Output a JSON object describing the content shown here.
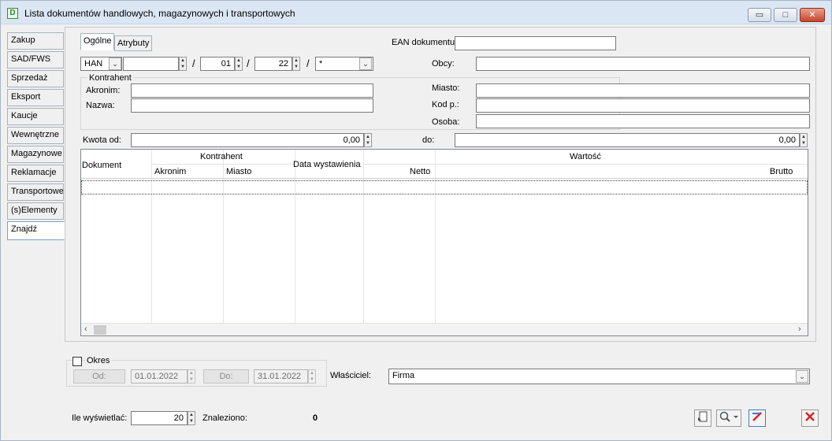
{
  "window": {
    "title": "Lista dokumentów handlowych, magazynowych i transportowych",
    "app_icon_letter": "D",
    "minimize_glyph": "▭",
    "maximize_glyph": "□",
    "close_glyph": "✕"
  },
  "sidebar": {
    "items": [
      {
        "label": "Zakup"
      },
      {
        "label": "SAD/FWS"
      },
      {
        "label": "Sprzedaż"
      },
      {
        "label": "Eksport"
      },
      {
        "label": "Kaucje"
      },
      {
        "label": "Wewnętrzne"
      },
      {
        "label": "Magazynowe"
      },
      {
        "label": "Reklamacje"
      },
      {
        "label": "Transportowe"
      },
      {
        "label": "(s)Elementy"
      },
      {
        "label": "Znajdź"
      }
    ],
    "active": "Znajdź"
  },
  "subtabs": [
    {
      "label": "Ogólne"
    },
    {
      "label": "Atrybuty"
    }
  ],
  "ean": {
    "label": "EAN dokumentu:",
    "value": ""
  },
  "doc_number": {
    "type_value": "HAN",
    "number_value": "",
    "sep1": "/",
    "month_value": "01",
    "sep2": "/",
    "year_value": "22",
    "sep3": "/",
    "series_value": "*"
  },
  "obcy": {
    "label": "Obcy:",
    "value": ""
  },
  "kontrahent": {
    "group_label": "Kontrahent",
    "akronim_label": "Akronim:",
    "akronim_value": "",
    "nazwa_label": "Nazwa:",
    "nazwa_value": ""
  },
  "miasto": {
    "label": "Miasto:",
    "value": ""
  },
  "kod": {
    "label": "Kod p.:",
    "value": ""
  },
  "osoba": {
    "label": "Osoba:",
    "value": ""
  },
  "kwota": {
    "from_label": "Kwota od:",
    "from_value": "0,00",
    "to_label": "do:",
    "to_value": "0,00"
  },
  "grid": {
    "col_dokument": "Dokument",
    "group_kontrahent": "Kontrahent",
    "col_akronim": "Akronim",
    "col_miasto": "Miasto",
    "col_data": "Data wystawienia",
    "group_wartosc": "Wartość",
    "col_netto": "Netto",
    "col_brutto": "Brutto",
    "rows": []
  },
  "okres": {
    "label": "Okres",
    "checked": false,
    "od_label": "Od:",
    "od_value": "01.01.2022",
    "do_label": "Do:",
    "do_value": "31.01.2022"
  },
  "wlasciciel": {
    "label": "Właściciel:",
    "value": "Firma"
  },
  "footer": {
    "ile_label": "Ile wyświetlać:",
    "ile_value": "20",
    "znaleziono_label": "Znaleziono:",
    "znaleziono_value": "0"
  },
  "icons": {
    "export": "export-list-icon",
    "search": "search-magnifier-icon",
    "clear": "clear-filter-icon",
    "close": "close-x-icon"
  }
}
